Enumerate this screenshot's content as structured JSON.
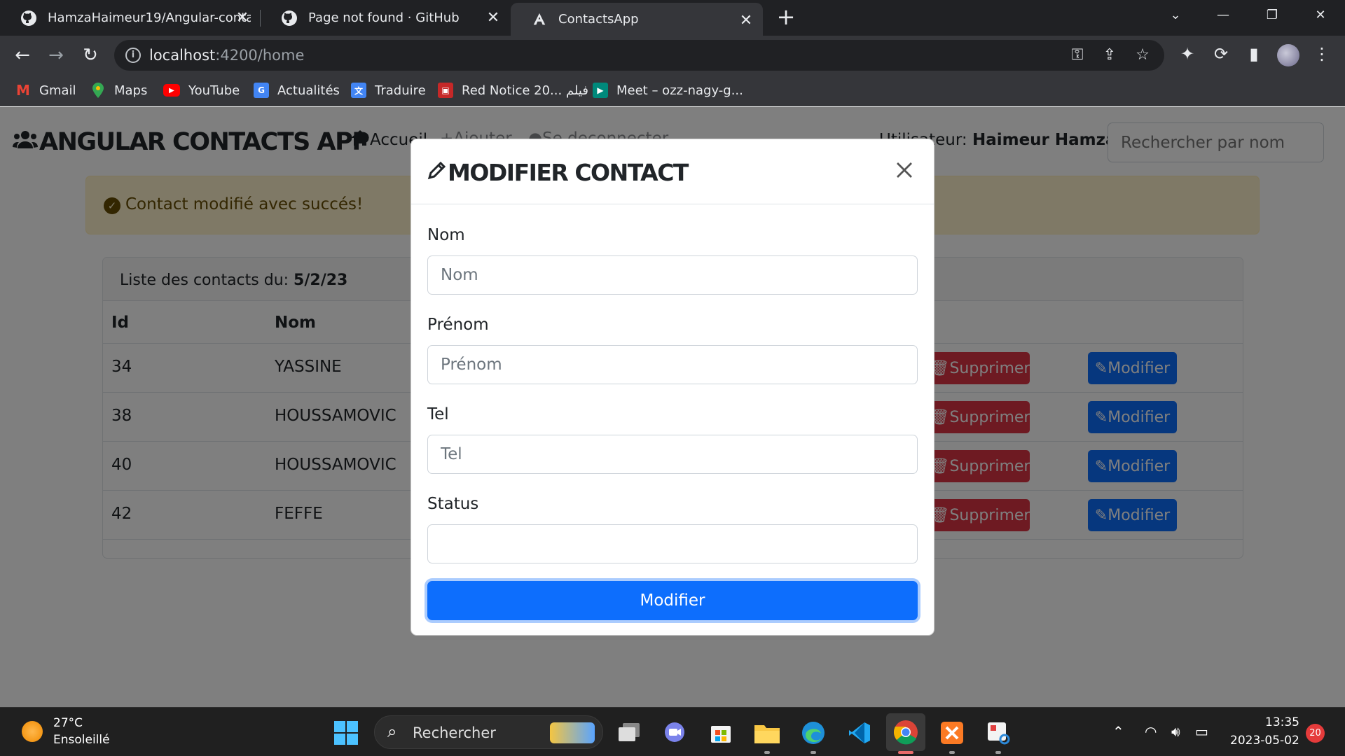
{
  "browser": {
    "tabs": [
      {
        "title": "HamzaHaimeur19/Angular-conta",
        "icon": "github-icon"
      },
      {
        "title": "Page not found · GitHub",
        "icon": "github-icon"
      },
      {
        "title": "ContactsApp",
        "icon": "angular-icon",
        "active": true
      }
    ],
    "url_host": "localhost",
    "url_path": ":4200/home",
    "bookmarks": [
      {
        "label": "Gmail",
        "icon": "gmail-icon"
      },
      {
        "label": "Maps",
        "icon": "maps-icon"
      },
      {
        "label": "YouTube",
        "icon": "youtube-icon"
      },
      {
        "label": "Actualités",
        "icon": "news-icon"
      },
      {
        "label": "Traduire",
        "icon": "translate-icon"
      },
      {
        "label": "Red Notice 20... فيلم",
        "icon": "movie-icon"
      },
      {
        "label": "Meet – ozz-nagy-g...",
        "icon": "meet-icon"
      }
    ]
  },
  "app": {
    "brand": "ANGULAR CONTACTS APP",
    "nav": {
      "home": "Accueil",
      "add": "Ajouter",
      "logout": "Se deconnecter"
    },
    "user_prefix": "Utilisateur: ",
    "user_name": "Haimeur Hamza",
    "search_placeholder": "Rechercher par nom",
    "alert": "Contact modifié avec succés!",
    "card": {
      "header_prefix": "Liste des contacts du: ",
      "date": "5/2/23",
      "columns": {
        "id": "Id",
        "nom": "Nom"
      },
      "rows": [
        {
          "id": "34",
          "nom": "YASSINE"
        },
        {
          "id": "38",
          "nom": "HOUSSAMOVIC"
        },
        {
          "id": "40",
          "nom": "HOUSSAMOVIC"
        },
        {
          "id": "42",
          "nom": "FEFFE"
        }
      ],
      "delete_label": "Supprimer",
      "edit_label": "Modifier"
    }
  },
  "modal": {
    "title": "MODIFIER CONTACT",
    "fields": {
      "nom_label": "Nom",
      "nom_placeholder": "Nom",
      "prenom_label": "Prénom",
      "prenom_placeholder": "Prénom",
      "tel_label": "Tel",
      "tel_placeholder": "Tel",
      "status_label": "Status",
      "status_value": ""
    },
    "submit": "Modifier"
  },
  "taskbar": {
    "temp": "27°C",
    "weather": "Ensoleillé",
    "search": "Rechercher",
    "time": "13:35",
    "date": "2023-05-02",
    "notifications": "20"
  },
  "colors": {
    "primary": "#0d6efd",
    "danger": "#dc3545",
    "warning_bg": "#fff3cd"
  }
}
